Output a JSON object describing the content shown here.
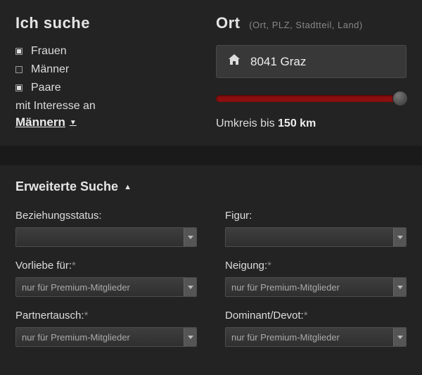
{
  "search": {
    "heading": "Ich suche",
    "options": {
      "women": {
        "label": "Frauen",
        "checked": true
      },
      "men": {
        "label": "Männer",
        "checked": false
      },
      "couples": {
        "label": "Paare",
        "checked": true
      }
    },
    "interest_label": "mit Interesse an",
    "interest_value": "Männern"
  },
  "location": {
    "heading": "Ort",
    "hint": "(Ort, PLZ, Stadtteil, Land)",
    "value": "8041 Graz",
    "radius_prefix": "Umkreis bis ",
    "radius_value": "150 km"
  },
  "advanced": {
    "heading": "Erweiterte Suche",
    "premium_placeholder": "nur für Premium-Mitglieder",
    "fields": {
      "relationship": "Beziehungsstatus:",
      "figure": "Figur:",
      "preference": "Vorliebe für:",
      "inclination": "Neigung:",
      "swap": "Partnertausch:",
      "domsub": "Dominant/Devot:"
    }
  }
}
